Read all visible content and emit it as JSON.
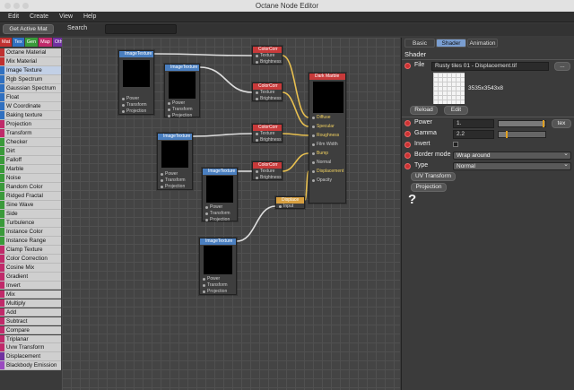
{
  "window": {
    "title": "Octane Node Editor",
    "traffic_lights": [
      "#ccc",
      "#ccc",
      "#ccc"
    ]
  },
  "menu": [
    "Edit",
    "Create",
    "View",
    "Help"
  ],
  "toolbar": {
    "get_active_mat": "Get Active Mat",
    "search_label": "Search",
    "search_value": ""
  },
  "categories": [
    {
      "label": "Mat",
      "color": "#c03030"
    },
    {
      "label": "Tex",
      "color": "#3070c0"
    },
    {
      "label": "Gen",
      "color": "#3a9a3a"
    },
    {
      "label": "Map",
      "color": "#c02a6a"
    },
    {
      "label": "Oth",
      "color": "#7030a0"
    },
    {
      "label": "Ems",
      "color": "#9a4ac0"
    },
    {
      "label": "Med",
      "color": "#3a8a6a"
    },
    {
      "label": "C4D",
      "color": "#777777"
    }
  ],
  "node_list": [
    {
      "label": "Octane Material",
      "color": "#c03030"
    },
    {
      "label": "Mix Material",
      "color": "#c03030"
    },
    {
      "label": "Image Texture",
      "color": "#3070c0",
      "selected": true
    },
    {
      "label": "Rgb Spectrum",
      "color": "#3070c0"
    },
    {
      "label": "Gaussian Spectrum",
      "color": "#3070c0"
    },
    {
      "label": "Float",
      "color": "#3070c0"
    },
    {
      "label": "W Coordinate",
      "color": "#3070c0"
    },
    {
      "label": "Baking texture",
      "color": "#3070c0"
    },
    {
      "label": "Projection",
      "color": "#c02a6a"
    },
    {
      "label": "Transform",
      "color": "#c02a6a"
    },
    {
      "label": "Checker",
      "color": "#3a9a3a"
    },
    {
      "label": "Dirt",
      "color": "#3a9a3a"
    },
    {
      "label": "Falloff",
      "color": "#3a9a3a"
    },
    {
      "label": "Marble",
      "color": "#3a9a3a"
    },
    {
      "label": "Noise",
      "color": "#3a9a3a"
    },
    {
      "label": "Random Color",
      "color": "#3a9a3a"
    },
    {
      "label": "Ridged Fractal",
      "color": "#3a9a3a"
    },
    {
      "label": "Sine Wave",
      "color": "#3a9a3a"
    },
    {
      "label": "Side",
      "color": "#3a9a3a"
    },
    {
      "label": "Turbulence",
      "color": "#3a9a3a"
    },
    {
      "label": "Instance Color",
      "color": "#3a9a3a"
    },
    {
      "label": "Instance Range",
      "color": "#3a9a3a"
    },
    {
      "label": "Clamp Texture",
      "color": "#c02a6a"
    },
    {
      "label": "Color Correction",
      "color": "#c02a6a"
    },
    {
      "label": "Cosine Mix",
      "color": "#c02a6a"
    },
    {
      "label": "Gradient",
      "color": "#c02a6a"
    },
    {
      "label": "Invert",
      "color": "#c02a6a"
    },
    {
      "label": "Mix",
      "color": "#c02a6a"
    },
    {
      "label": "Multiply",
      "color": "#c02a6a"
    },
    {
      "label": "Add",
      "color": "#c02a6a"
    },
    {
      "label": "Subtract",
      "color": "#c02a6a"
    },
    {
      "label": "Compare",
      "color": "#c02a6a"
    },
    {
      "label": "Triplanar",
      "color": "#c02a6a"
    },
    {
      "label": "Uvw Transform",
      "color": "#c02a6a"
    },
    {
      "label": "Displacement",
      "color": "#7030a0"
    },
    {
      "label": "Blackbody Emission",
      "color": "#9a4ac0"
    }
  ],
  "nodes": {
    "imgtex_1": {
      "title": "ImageTexture",
      "pins": [
        "Power",
        "Transform",
        "Projection"
      ]
    },
    "imgtex_2": {
      "title": "ImageTexture",
      "pins": [
        "Power",
        "Transform",
        "Projection"
      ]
    },
    "imgtex_3": {
      "title": "ImageTexture",
      "pins": [
        "Power",
        "Transform",
        "Projection"
      ]
    },
    "imgtex_4": {
      "title": "ImageTexture",
      "pins": [
        "Power",
        "Transform",
        "Projection"
      ]
    },
    "imgtex_5": {
      "title": "ImageTexture",
      "pins": [
        "Power",
        "Transform",
        "Projection"
      ]
    },
    "cc_1": {
      "title": "ColorCorr",
      "pins": [
        "Texture",
        "Brightness"
      ]
    },
    "cc_2": {
      "title": "ColorCorr",
      "pins": [
        "Texture",
        "Brightness"
      ]
    },
    "cc_3": {
      "title": "ColorCorr",
      "pins": [
        "Texture",
        "Brightness"
      ]
    },
    "cc_4": {
      "title": "ColorCorr",
      "pins": [
        "Texture",
        "Brightness"
      ]
    },
    "disp": {
      "title": "Displace",
      "pins": [
        "Input"
      ]
    },
    "mat": {
      "title": "Dark Marble",
      "pins": [
        "Diffuse",
        "Specular",
        "Roughness",
        "Film Width",
        "Bump",
        "Normal",
        "Displacement",
        "Opacity"
      ]
    }
  },
  "panel": {
    "tabs": [
      "Basic",
      "Shader",
      "Animation"
    ],
    "active_tab": "Shader",
    "section": "Shader",
    "file_label": "File",
    "file_value": "Rusty tiles 01 - Displacement.tif",
    "browse": "...",
    "resolution": "3535x3543x8",
    "reload": "Reload",
    "edit": "Edit",
    "power_label": "Power",
    "power_value": "1.",
    "power_level": 0.97,
    "tex_button": "tex",
    "gamma_label": "Gamma",
    "gamma_value": "2.2",
    "gamma_level": 0.18,
    "invert_label": "Invert",
    "border_label": "Border mode",
    "border_value": "Wrap around",
    "type_label": "Type",
    "type_value": "Normal",
    "uv_transform": "UV Transform",
    "projection": "Projection",
    "help_glyph": "?"
  },
  "colors": {
    "tex_header": "#4a7fc0",
    "cc_header": "#c83a3a",
    "mat_header": "#c83a3a",
    "disp_header": "#d8a040",
    "wire_white": "#dddddd",
    "wire_yellow": "#e8c050"
  }
}
